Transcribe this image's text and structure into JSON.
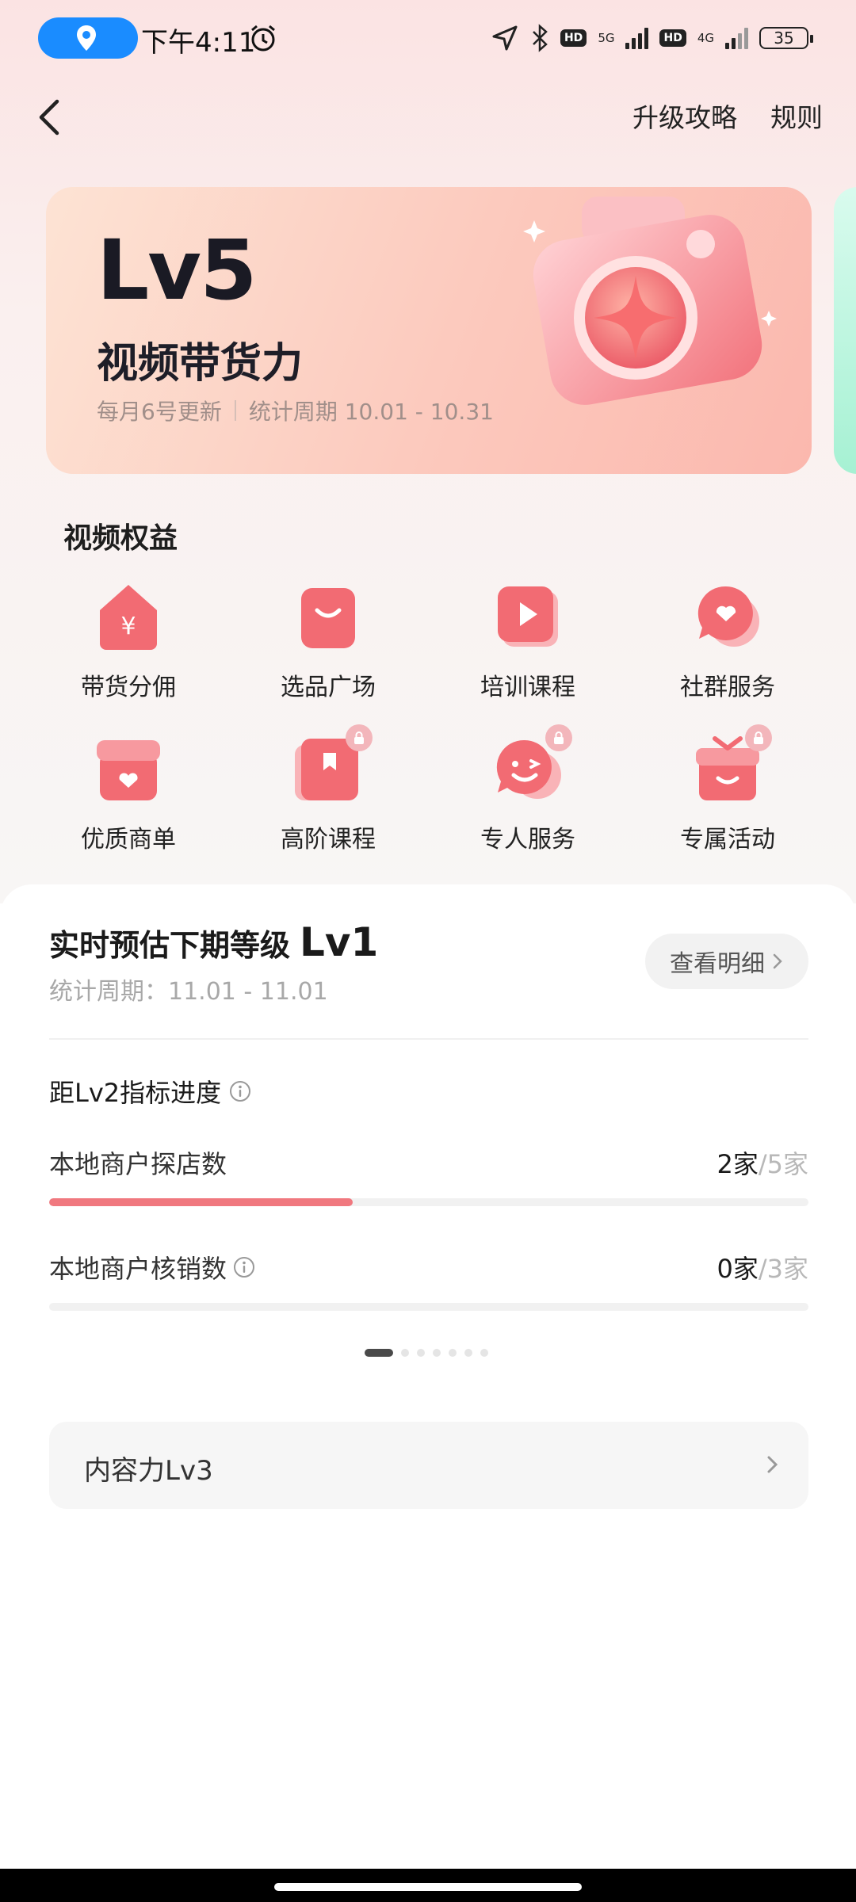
{
  "status_bar": {
    "time": "下午4:11",
    "net1": "5G",
    "net2": "4G",
    "hd": "HD",
    "battery": "35"
  },
  "header": {
    "upgrade_guide": "升级攻略",
    "rules": "规则"
  },
  "hero": {
    "level": "Lv5",
    "title": "视频带货力",
    "update_note": "每月6号更新",
    "period": "统计周期 10.01 - 10.31"
  },
  "benefits": {
    "title": "视频权益",
    "items": [
      {
        "label": "带货分佣",
        "icon": "commission-icon",
        "locked": false
      },
      {
        "label": "选品广场",
        "icon": "shopping-bag-icon",
        "locked": false
      },
      {
        "label": "培训课程",
        "icon": "play-icon",
        "locked": false
      },
      {
        "label": "社群服务",
        "icon": "heart-chat-icon",
        "locked": false
      },
      {
        "label": "优质商单",
        "icon": "store-heart-icon",
        "locked": false
      },
      {
        "label": "高阶课程",
        "icon": "book-icon",
        "locked": true
      },
      {
        "label": "专人服务",
        "icon": "smile-chat-icon",
        "locked": true
      },
      {
        "label": "专属活动",
        "icon": "gift-icon",
        "locked": true
      }
    ]
  },
  "estimate": {
    "title": "实时预估下期等级",
    "level": "Lv1",
    "period": "统计周期：11.01 - 11.01",
    "detail_button": "查看明细"
  },
  "progress": {
    "title": "距Lv2指标进度",
    "metrics": [
      {
        "label": "本地商户探店数",
        "current": "2家",
        "total": "/5家",
        "fraction": 0.4
      },
      {
        "label": "本地商户核销数",
        "current": "0家",
        "total": "/3家",
        "fraction": 0.0
      }
    ],
    "page_count": 7,
    "active_page": 0
  },
  "content_power": {
    "label": "内容力Lv3"
  },
  "colors": {
    "accent": "#f0787f",
    "icon_pink": "#f26b73"
  }
}
